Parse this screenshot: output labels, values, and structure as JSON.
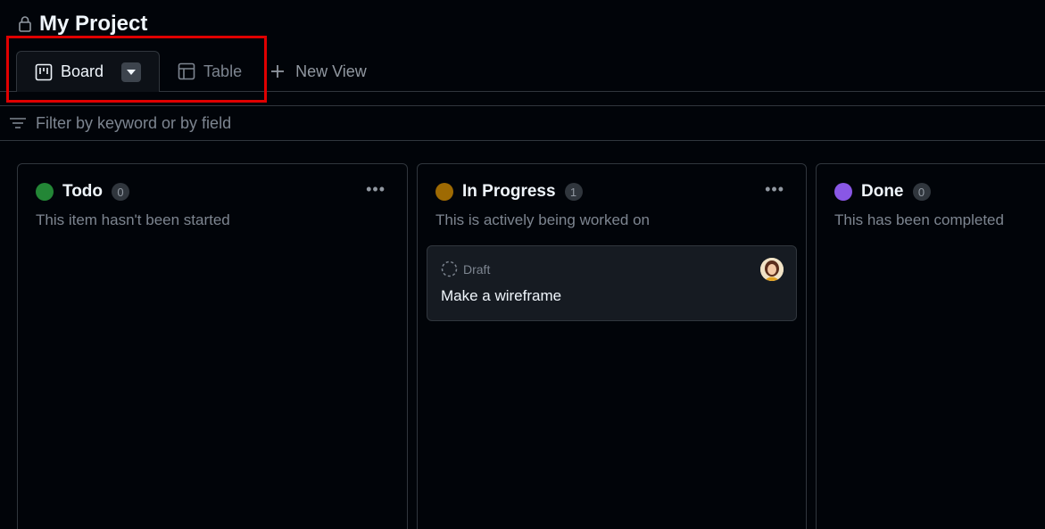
{
  "project": {
    "title": "My Project"
  },
  "tabs": [
    {
      "label": "Board",
      "active": true
    },
    {
      "label": "Table",
      "active": false
    }
  ],
  "new_view": {
    "label": "New View"
  },
  "filter": {
    "placeholder": "Filter by keyword or by field"
  },
  "columns": [
    {
      "title": "Todo",
      "count": "0",
      "description": "This item hasn't been started",
      "color": "#238636"
    },
    {
      "title": "In Progress",
      "count": "1",
      "description": "This is actively being worked on",
      "color": "#9e6a03",
      "cards": [
        {
          "status": "Draft",
          "title": "Make a wireframe"
        }
      ]
    },
    {
      "title": "Done",
      "count": "0",
      "description": "This has been completed",
      "color": "#8957e5"
    }
  ],
  "colors": {
    "background": "#010409",
    "border": "#30363d",
    "highlight": "#e00000"
  }
}
